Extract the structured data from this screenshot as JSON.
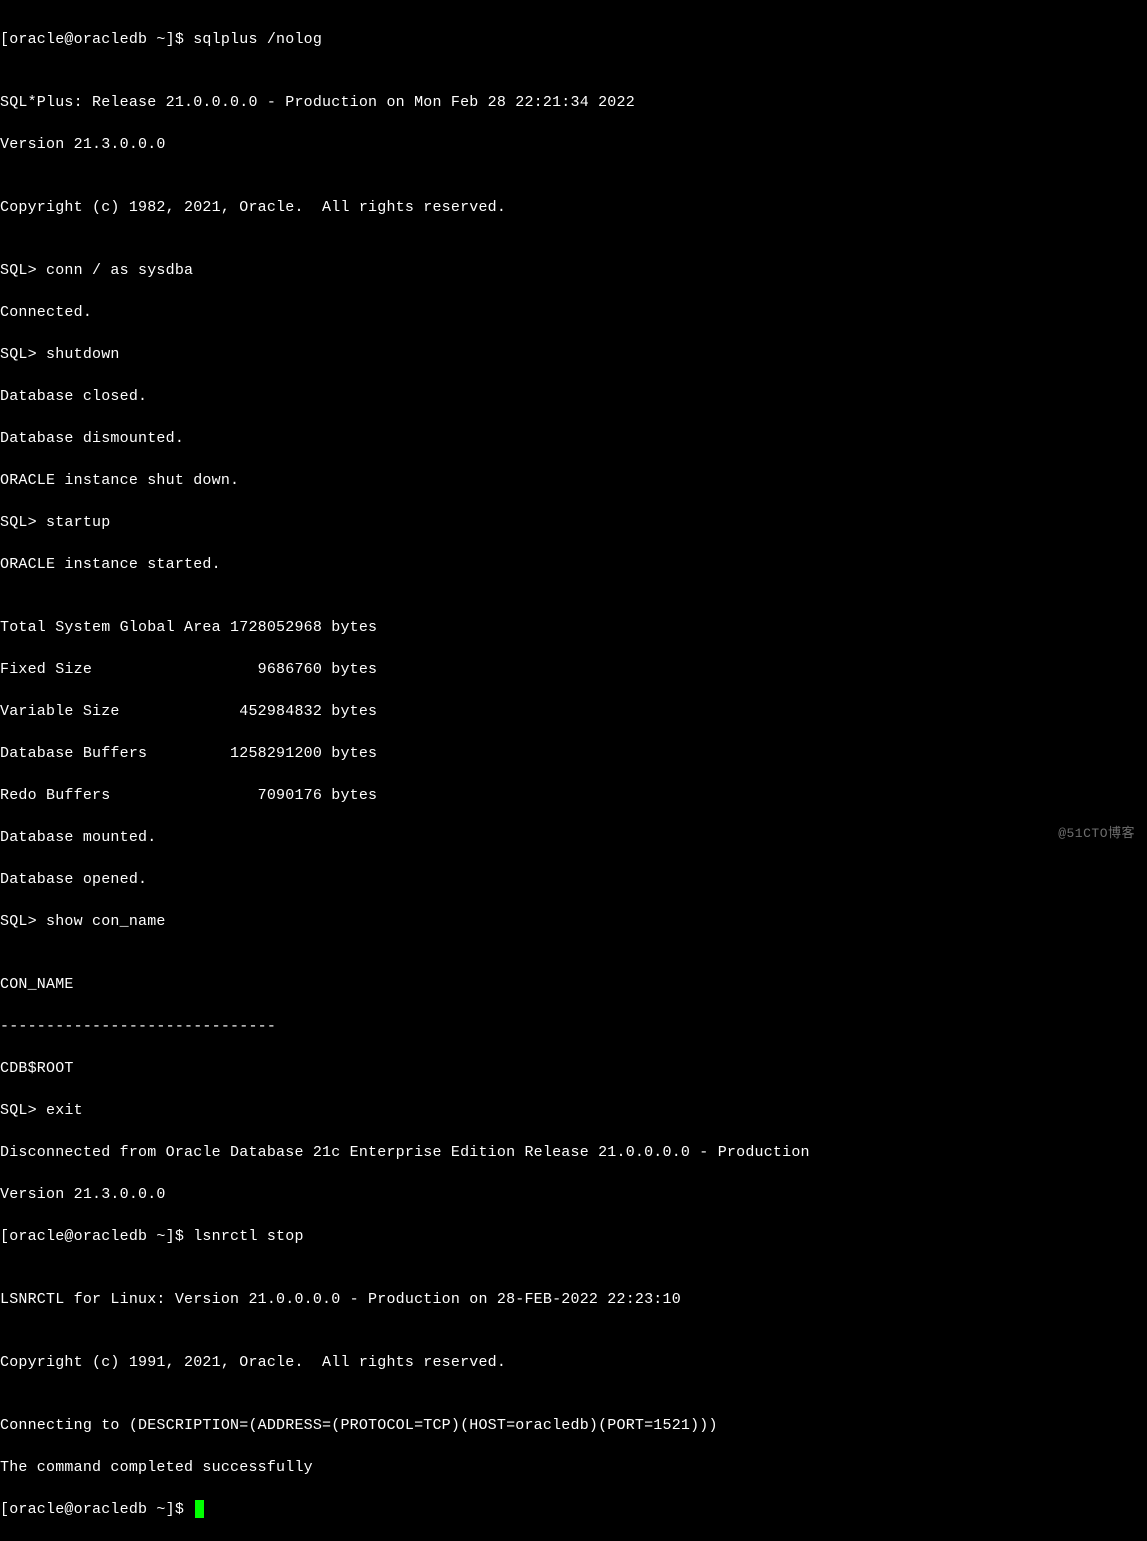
{
  "terminal": {
    "lines": [
      "[oracle@oracledb ~]$ sqlplus /nolog",
      "",
      "SQL*Plus: Release 21.0.0.0.0 - Production on Mon Feb 28 22:21:34 2022",
      "Version 21.3.0.0.0",
      "",
      "Copyright (c) 1982, 2021, Oracle.  All rights reserved.",
      "",
      "SQL> conn / as sysdba",
      "Connected.",
      "SQL> shutdown",
      "Database closed.",
      "Database dismounted.",
      "ORACLE instance shut down.",
      "SQL> startup",
      "ORACLE instance started.",
      "",
      "Total System Global Area 1728052968 bytes",
      "Fixed Size                  9686760 bytes",
      "Variable Size             452984832 bytes",
      "Database Buffers         1258291200 bytes",
      "Redo Buffers                7090176 bytes",
      "Database mounted.",
      "Database opened.",
      "SQL> show con_name",
      "",
      "CON_NAME",
      "------------------------------",
      "CDB$ROOT",
      "SQL> exit",
      "Disconnected from Oracle Database 21c Enterprise Edition Release 21.0.0.0.0 - Production",
      "Version 21.3.0.0.0",
      "[oracle@oracledb ~]$ lsnrctl stop",
      "",
      "LSNRCTL for Linux: Version 21.0.0.0.0 - Production on 28-FEB-2022 22:23:10",
      "",
      "Copyright (c) 1991, 2021, Oracle.  All rights reserved.",
      "",
      "Connecting to (DESCRIPTION=(ADDRESS=(PROTOCOL=TCP)(HOST=oracledb)(PORT=1521)))",
      "The command completed successfully"
    ],
    "final_prompt": "[oracle@oracledb ~]$ "
  },
  "watermark": "@51CTO博客"
}
